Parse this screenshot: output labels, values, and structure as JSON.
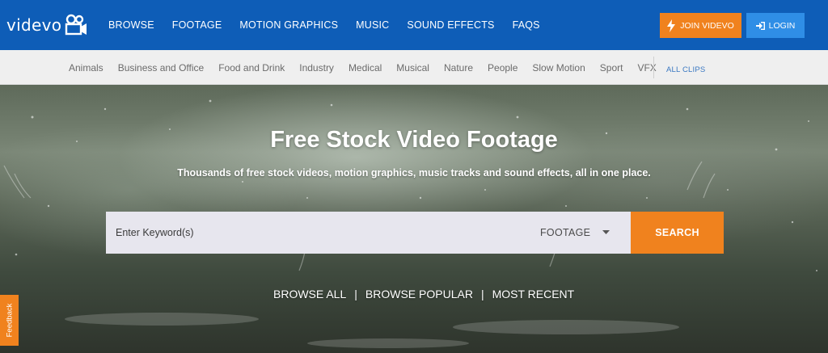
{
  "brand": {
    "name": "videvo",
    "icon": "video-camera-icon"
  },
  "nav": {
    "items": [
      {
        "label": "BROWSE"
      },
      {
        "label": "FOOTAGE"
      },
      {
        "label": "MOTION GRAPHICS"
      },
      {
        "label": "MUSIC"
      },
      {
        "label": "SOUND EFFECTS"
      },
      {
        "label": "FAQS"
      }
    ],
    "join_label": "JOIN VIDEVO",
    "join_icon": "lightning-bolt-icon",
    "login_label": "LOGIN",
    "login_icon": "sign-in-icon"
  },
  "categories": {
    "items": [
      {
        "label": "Animals"
      },
      {
        "label": "Business and Office"
      },
      {
        "label": "Food and Drink"
      },
      {
        "label": "Industry"
      },
      {
        "label": "Medical"
      },
      {
        "label": "Musical"
      },
      {
        "label": "Nature"
      },
      {
        "label": "People"
      },
      {
        "label": "Slow Motion"
      },
      {
        "label": "Sport"
      },
      {
        "label": "VFX"
      }
    ],
    "all_clips_label": "ALL CLIPS"
  },
  "hero": {
    "title": "Free Stock Video Footage",
    "subtitle": "Thousands of free stock videos, motion graphics, music tracks and sound effects, all in one place."
  },
  "search": {
    "placeholder": "Enter Keyword(s)",
    "value": "",
    "type_selected": "FOOTAGE",
    "button_label": "SEARCH"
  },
  "quicklinks": {
    "browse_all": "BROWSE ALL",
    "browse_popular": "BROWSE POPULAR",
    "most_recent": "MOST RECENT",
    "separator": "|"
  },
  "feedback": {
    "label": "Feedback"
  },
  "colors": {
    "topbar": "#0e5db7",
    "accent_orange": "#f0821e",
    "login_blue": "#2f8ee6",
    "category_bar": "#efefef",
    "all_clips_link": "#3a78c2"
  }
}
